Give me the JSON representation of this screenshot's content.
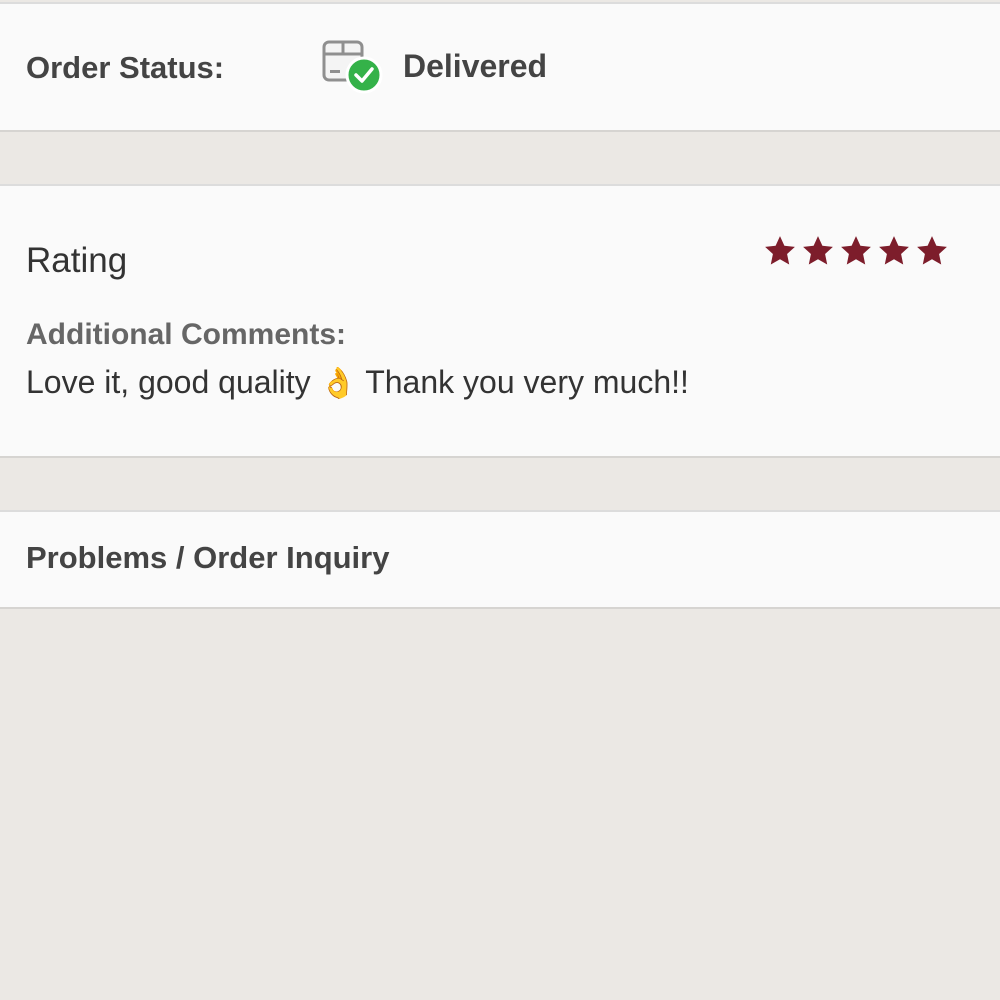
{
  "order_status": {
    "label": "Order Status:",
    "value": "Delivered",
    "icon": "package-delivered-icon",
    "check_color": "#34b249"
  },
  "review": {
    "rating_label": "Rating",
    "rating_value": 5,
    "rating_max": 5,
    "star_color": "#7d1d2b",
    "comments_label": "Additional Comments:",
    "comment_before": "Love it, good quality",
    "comment_emoji": "👌",
    "comment_after": "Thank you very much!!"
  },
  "inquiry": {
    "label": "Problems / Order Inquiry"
  }
}
